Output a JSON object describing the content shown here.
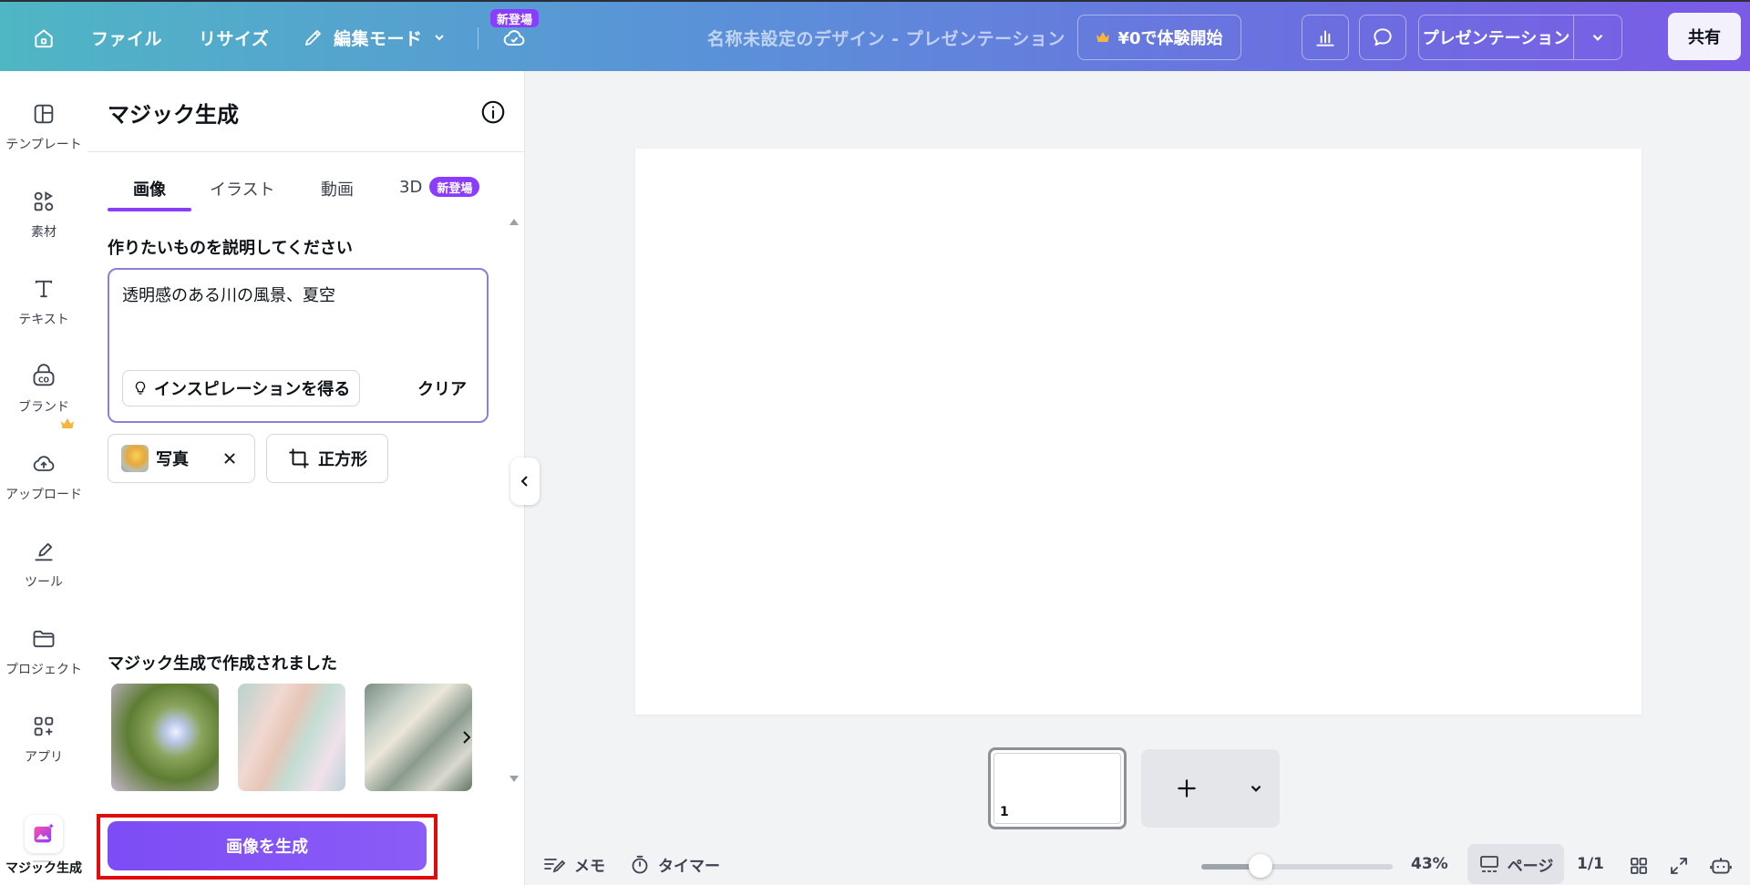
{
  "topbar": {
    "menu_file": "ファイル",
    "menu_resize": "リサイズ",
    "menu_edit_mode": "編集モード",
    "new_badge": "新登場",
    "design_title": "名称未設定のデザイン - プレゼンテーション",
    "trial_button": "¥0で体験開始",
    "present_button": "プレゼンテーション",
    "share_button": "共有"
  },
  "rail": {
    "items": [
      {
        "label": "テンプレート"
      },
      {
        "label": "素材"
      },
      {
        "label": "テキスト"
      },
      {
        "label": "ブランド"
      },
      {
        "label": "アップロード"
      },
      {
        "label": "ツール"
      },
      {
        "label": "プロジェクト"
      },
      {
        "label": "アプリ"
      },
      {
        "label": "マジック生成"
      }
    ]
  },
  "panel": {
    "title": "マジック生成",
    "tabs": [
      {
        "label": "画像",
        "active": true
      },
      {
        "label": "イラスト"
      },
      {
        "label": "動画"
      },
      {
        "label": "3D",
        "badge": "新登場"
      }
    ],
    "description_label": "作りたいものを説明してください",
    "prompt_value": "透明感のある川の風景、夏空",
    "inspiration_button": "インスピレーションを得る",
    "clear_button": "クリア",
    "style_chip": "写真",
    "ratio_chip": "正方形",
    "made_with_label": "マジック生成で作成されました",
    "generate_button": "画像を生成"
  },
  "pages": {
    "current_page_number": "1"
  },
  "bottombar": {
    "notes": "メモ",
    "timer": "タイマー",
    "zoom": "43%",
    "zoom_level": 0.43,
    "pages_button": "ページ",
    "page_count": "1/1"
  },
  "colors": {
    "accent": "#8b3dff",
    "generate_highlight": "#e20b0b"
  }
}
